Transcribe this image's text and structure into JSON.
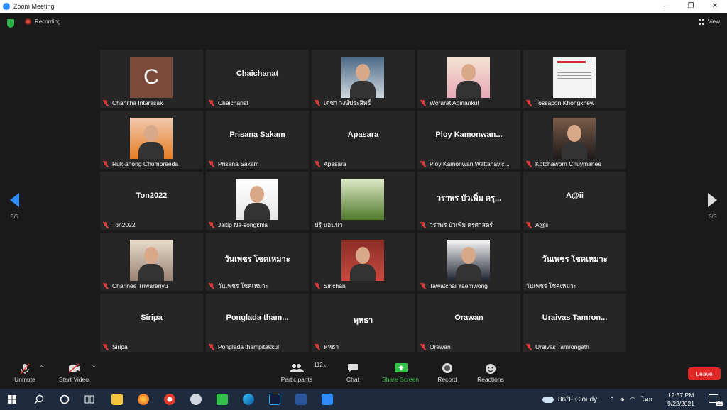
{
  "window": {
    "title": "Zoom Meeting"
  },
  "topbar": {
    "recording_label": "Recording",
    "view_label": "View"
  },
  "gallery": {
    "tiles": [
      {
        "label": "Chanitha Intarasak",
        "big": "",
        "initial": "C"
      },
      {
        "label": "Chaichanat",
        "big": "Chaichanat"
      },
      {
        "label": "เดชา วงษ์ประสิทธิ์",
        "big": ""
      },
      {
        "label": "Worarat Apinankul",
        "big": ""
      },
      {
        "label": "Tossapon Khongkhew",
        "big": ""
      },
      {
        "label": "Ruk-anong Chompreeda",
        "big": ""
      },
      {
        "label": "Prisana Sakam",
        "big": "Prisana Sakam"
      },
      {
        "label": "Apasara",
        "big": "Apasara"
      },
      {
        "label": "Ploy Kamonwan Wattanavic...",
        "big": "Ploy  Kamonwan..."
      },
      {
        "label": "Kotchaworn Chuymanee",
        "big": ""
      },
      {
        "label": "Ton2022",
        "big": "Ton2022"
      },
      {
        "label": "Jaitip Na-songkhla",
        "big": ""
      },
      {
        "label": "ปรุ๊ นอนนา",
        "big": ""
      },
      {
        "label": "วราพร บัวเพิ่ม ครุศาสตร์",
        "big": "วราพร บัวเพิ่ม ครุ..."
      },
      {
        "label": "A@ii",
        "big": "A@ii"
      },
      {
        "label": "Charinee Triwaranyu",
        "big": ""
      },
      {
        "label": "วันเพชร โชคเหมาะ",
        "big": "วันเพชร โชคเหมาะ"
      },
      {
        "label": "Sirichan",
        "big": ""
      },
      {
        "label": "Tawatchai Yaemwong",
        "big": ""
      },
      {
        "label": "วันเพชร โชคเหมาะ",
        "big": "วันเพชร โชคเหมาะ"
      },
      {
        "label": "Siripa",
        "big": "Siripa"
      },
      {
        "label": "Ponglada thampitakkul",
        "big": "Ponglada  tham..."
      },
      {
        "label": "พุหธา",
        "big": "พุหธา"
      },
      {
        "label": "Orawan",
        "big": "Orawan"
      },
      {
        "label": "Uraivas Tamrongath",
        "big": "Uraivas  Tamron..."
      }
    ],
    "page_left": "5/5",
    "page_right": "5/5"
  },
  "toolbar": {
    "unmute": "Unmute",
    "start_video": "Start Video",
    "participants": "Participants",
    "participants_count": "112",
    "chat": "Chat",
    "share_screen": "Share Screen",
    "record": "Record",
    "reactions": "Reactions",
    "leave": "Leave"
  },
  "taskbar": {
    "weather": "86°F  Cloudy",
    "lang": "ไทย",
    "time": "12:37 PM",
    "date": "9/22/2021",
    "notif_count": "11"
  },
  "colors": {
    "accent": "#2d8cff",
    "leave": "#e02828",
    "share": "#35c24a",
    "muted_mic": "#e03c3c"
  }
}
